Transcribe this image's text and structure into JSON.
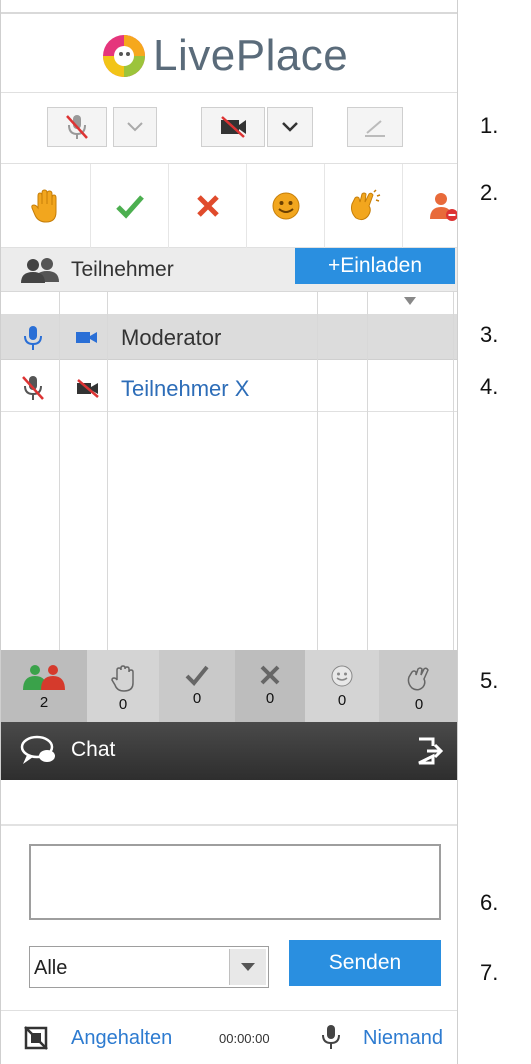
{
  "app": {
    "brand": "LivePlace"
  },
  "participants": {
    "title": "Teilnehmer",
    "invite_label": "+Einladen",
    "rows": [
      {
        "name": "Moderator"
      },
      {
        "name": "Teilnehmer X"
      }
    ]
  },
  "counts": [
    "2",
    "0",
    "0",
    "0",
    "0",
    "0"
  ],
  "chat": {
    "title": "Chat"
  },
  "composer": {
    "select_value": "Alle",
    "send_label": "Senden"
  },
  "footer": {
    "recording": "Angehalten",
    "time": "00:00:00",
    "speaker": "Niemand"
  },
  "numbers": [
    "1.",
    "2.",
    "3.",
    "4.",
    "5.",
    "6.",
    "7."
  ],
  "colors": {
    "accent": "#2a8fe0",
    "yes": "#4caf50",
    "no": "#e04b2c",
    "smile": "#f2a61e"
  }
}
